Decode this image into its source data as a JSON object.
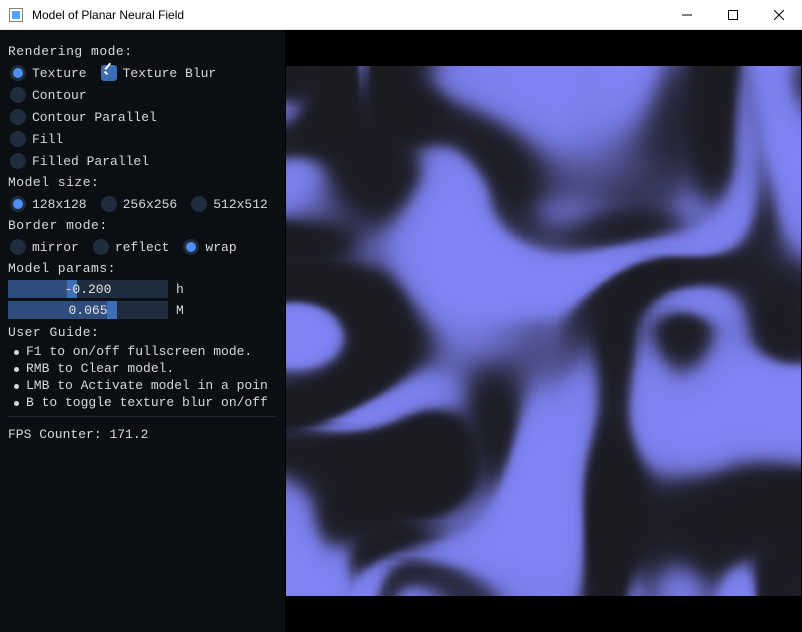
{
  "window": {
    "title": "Model of Planar Neural Field"
  },
  "sidebar": {
    "rendering": {
      "label": "Rendering mode:",
      "options": [
        {
          "label": "Texture",
          "checked": true
        },
        {
          "label": "Texture Blur",
          "checked": true,
          "kind": "checkbox"
        },
        {
          "label": "Contour",
          "checked": false
        },
        {
          "label": "Contour Parallel",
          "checked": false
        },
        {
          "label": "Fill",
          "checked": false
        },
        {
          "label": "Filled Parallel",
          "checked": false
        }
      ]
    },
    "model_size": {
      "label": "Model size:",
      "options": [
        {
          "label": "128x128",
          "checked": true
        },
        {
          "label": "256x256",
          "checked": false
        },
        {
          "label": "512x512",
          "checked": false
        }
      ]
    },
    "border_mode": {
      "label": "Border mode:",
      "options": [
        {
          "label": "mirror",
          "checked": false
        },
        {
          "label": "reflect",
          "checked": false
        },
        {
          "label": "wrap",
          "checked": true
        }
      ]
    },
    "params": {
      "label": "Model params:",
      "sliders": [
        {
          "name": "h",
          "display": "-0.200",
          "value": -0.2,
          "min": -1.0,
          "max": 1.0
        },
        {
          "name": "M",
          "display": "0.065",
          "value": 0.065,
          "min": 0.0,
          "max": 0.1
        }
      ]
    },
    "guide": {
      "label": "User Guide:",
      "items": [
        "F1 to on/off fullscreen mode.",
        "RMB to Clear model.",
        "LMB to Activate model in a poin",
        "B to toggle texture blur on/off"
      ]
    },
    "fps": {
      "label": "FPS Counter:",
      "value": "171.2"
    }
  },
  "field_color": "#7f83f4",
  "bg_color": "#1b1b22"
}
